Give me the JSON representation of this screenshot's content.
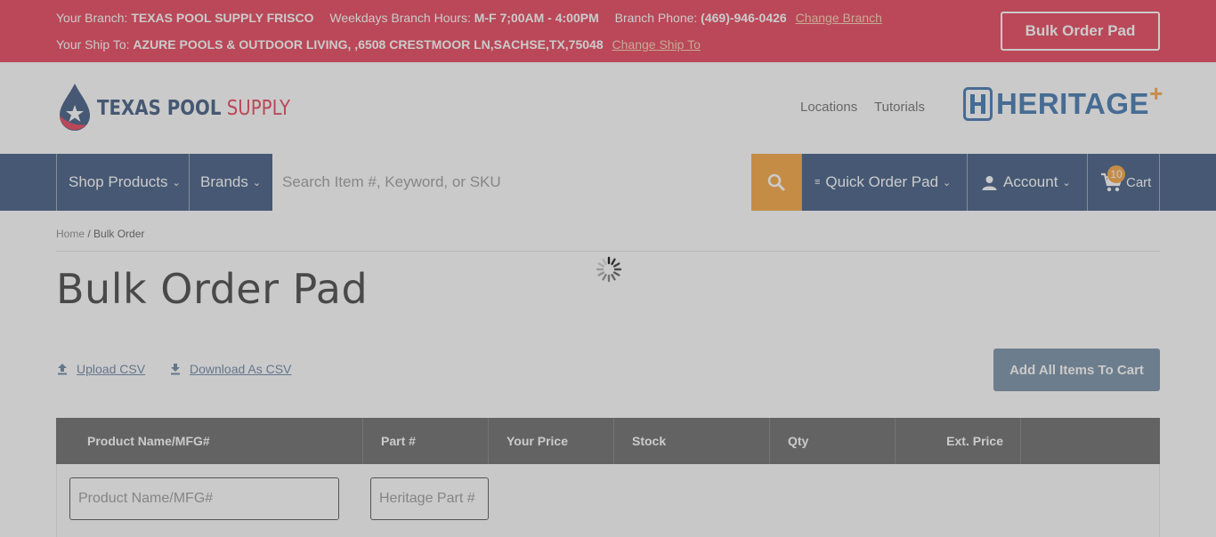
{
  "topbar": {
    "branch_label": "Your Branch:",
    "branch_value": "TEXAS POOL SUPPLY FRISCO",
    "hours_label": "Weekdays Branch Hours:",
    "hours_value": "M-F 7;00AM - 4:00PM",
    "phone_label": "Branch Phone:",
    "phone_value": "(469)-946-0426",
    "change_branch": "Change Branch",
    "shipto_label": "Your Ship To:",
    "shipto_value": "AZURE POOLS & OUTDOOR LIVING, ,6508 CRESTMOOR LN,SACHSE,TX,75048",
    "change_shipto": "Change Ship To",
    "bulk_order_pad": "Bulk Order Pad"
  },
  "header": {
    "logo_word1": "TEXAS POOL",
    "logo_word2": "SUPPLY",
    "locations": "Locations",
    "tutorials": "Tutorials",
    "partner_logo": "HERITAGE",
    "partner_plus": "+"
  },
  "nav": {
    "shop_products": "Shop Products",
    "brands": "Brands",
    "search_placeholder": "Search Item #, Keyword, or SKU",
    "quick_order_pad": "Quick Order Pad",
    "account": "Account",
    "cart": "Cart",
    "cart_count": "10"
  },
  "breadcrumb": {
    "home": "Home",
    "separator": " / ",
    "current": "Bulk Order"
  },
  "page": {
    "title": "Bulk Order Pad",
    "upload_csv": "Upload CSV",
    "download_csv": "Download As CSV",
    "add_all": "Add All Items To Cart"
  },
  "table": {
    "headers": [
      "Product Name/MFG#",
      "Part #",
      "Your Price",
      "Stock",
      "Qty",
      "Ext. Price"
    ],
    "product_placeholder": "Product Name/MFG#",
    "part_placeholder": "Heritage Part #"
  },
  "colors": {
    "brand_red": "#e4203b",
    "brand_navy": "#1d3c6a",
    "accent_orange": "#f7941d",
    "button_slate": "#5e7a97"
  },
  "icons": {
    "search": "search-icon",
    "cart": "cart-icon",
    "account": "person-icon",
    "quick_order": "list-icon",
    "upload": "upload-icon",
    "download": "download-icon",
    "loading": "spinner-icon"
  }
}
